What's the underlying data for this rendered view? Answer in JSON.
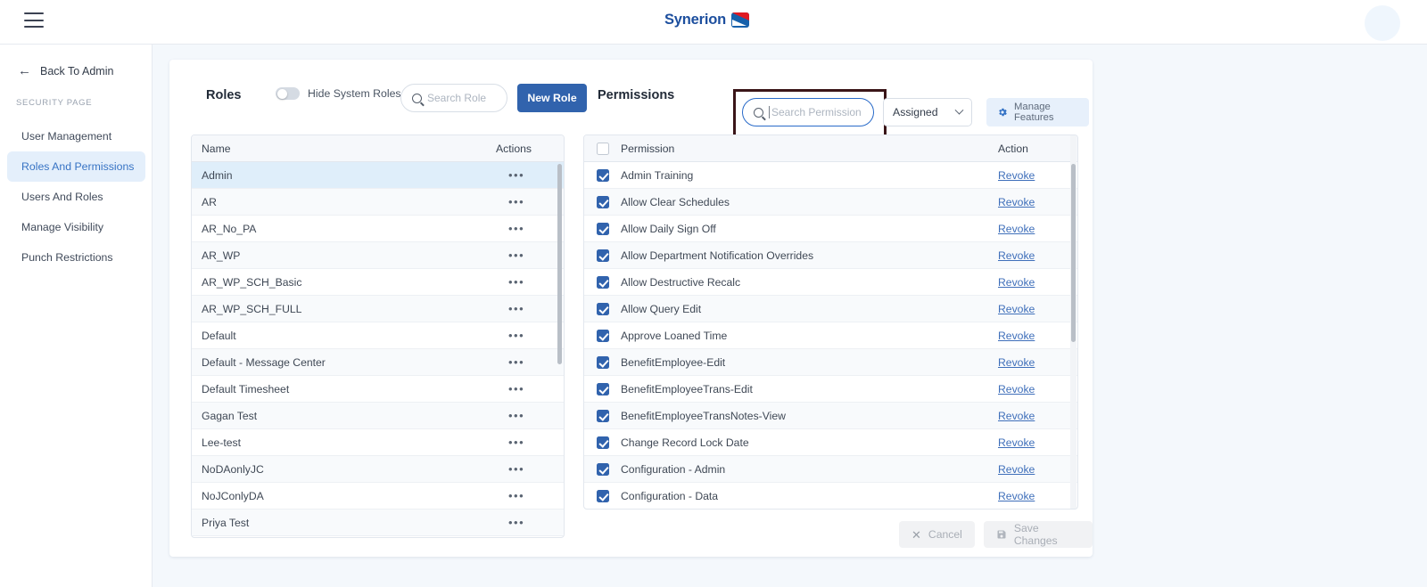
{
  "topbar": {
    "menu_icon": "hamburger-icon",
    "logo_text": "Synerion",
    "avatar_icon": "user-avatar"
  },
  "sidebar": {
    "back_label": "Back To Admin",
    "section_label": "SECURITY PAGE",
    "items": [
      {
        "label": "User Management",
        "active": false
      },
      {
        "label": "Roles And Permissions",
        "active": true
      },
      {
        "label": "Users And Roles",
        "active": false
      },
      {
        "label": "Manage Visibility",
        "active": false
      },
      {
        "label": "Punch Restrictions",
        "active": false
      }
    ]
  },
  "roles_panel": {
    "title": "Roles",
    "hide_system_roles_label": "Hide System Roles",
    "hide_system_roles_on": false,
    "search_placeholder": "Search Role",
    "search_value": "",
    "new_role_label": "New Role",
    "columns": {
      "name": "Name",
      "actions": "Actions"
    },
    "rows": [
      {
        "name": "Admin",
        "selected": true
      },
      {
        "name": "AR",
        "selected": false
      },
      {
        "name": "AR_No_PA",
        "selected": false
      },
      {
        "name": "AR_WP",
        "selected": false
      },
      {
        "name": "AR_WP_SCH_Basic",
        "selected": false
      },
      {
        "name": "AR_WP_SCH_FULL",
        "selected": false
      },
      {
        "name": "Default",
        "selected": false
      },
      {
        "name": "Default - Message Center",
        "selected": false
      },
      {
        "name": "Default Timesheet",
        "selected": false
      },
      {
        "name": "Gagan Test",
        "selected": false
      },
      {
        "name": "Lee-test",
        "selected": false
      },
      {
        "name": "NoDAonlyJC",
        "selected": false
      },
      {
        "name": "NoJConlyDA",
        "selected": false
      },
      {
        "name": "Priya Test",
        "selected": false
      }
    ],
    "row_action_icon": "ellipsis-icon"
  },
  "permissions_panel": {
    "title": "Permissions",
    "search_placeholder": "Search Permission",
    "search_value": "",
    "search_focused": true,
    "filter_value": "Assigned",
    "manage_features_label": "Manage Features",
    "columns": {
      "permission": "Permission",
      "action": "Action"
    },
    "header_checkbox_checked": false,
    "revoke_label": "Revoke",
    "rows": [
      {
        "name": "Admin Training",
        "checked": true
      },
      {
        "name": "Allow Clear Schedules",
        "checked": true
      },
      {
        "name": "Allow Daily Sign Off",
        "checked": true
      },
      {
        "name": "Allow Department Notification Overrides",
        "checked": true
      },
      {
        "name": "Allow Destructive Recalc",
        "checked": true
      },
      {
        "name": "Allow Query Edit",
        "checked": true
      },
      {
        "name": "Approve Loaned Time",
        "checked": true
      },
      {
        "name": "BenefitEmployee-Edit",
        "checked": true
      },
      {
        "name": "BenefitEmployeeTrans-Edit",
        "checked": true
      },
      {
        "name": "BenefitEmployeeTransNotes-View",
        "checked": true
      },
      {
        "name": "Change Record Lock Date",
        "checked": true
      },
      {
        "name": "Configuration - Admin",
        "checked": true
      },
      {
        "name": "Configuration - Data",
        "checked": true
      }
    ]
  },
  "footer": {
    "cancel_label": "Cancel",
    "save_label": "Save Changes",
    "disabled": true
  },
  "colors": {
    "accent_blue": "#3163ad",
    "link_blue": "#3f6fba",
    "selected_row": "#dfeefa",
    "page_bg": "#f4f8fc",
    "annotation": "#3a1518"
  }
}
